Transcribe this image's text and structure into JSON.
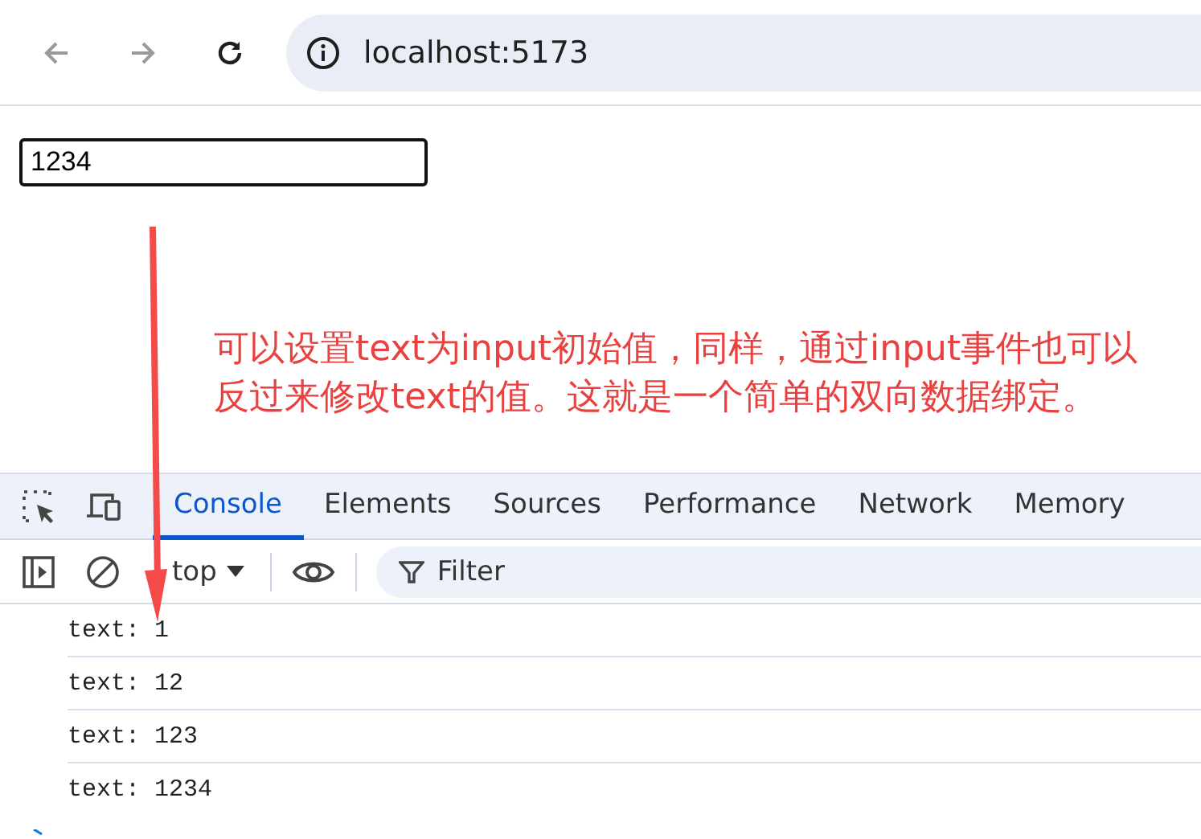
{
  "browser": {
    "nav_buttons": [
      {
        "kind": "back",
        "disabled": true
      },
      {
        "kind": "forward",
        "disabled": true
      },
      {
        "kind": "reload",
        "disabled": false
      }
    ],
    "url": "localhost:5173"
  },
  "page": {
    "input": {
      "value": "1234"
    }
  },
  "annotation": {
    "text": "可以设置text为input初始值，同样，通过input事件也可以反过来修改text的值。这就是一个简单的双向数据绑定。"
  },
  "devtools": {
    "tabs": [
      {
        "label": "Console",
        "selected": true
      },
      {
        "label": "Elements",
        "selected": false
      },
      {
        "label": "Sources",
        "selected": false
      },
      {
        "label": "Performance",
        "selected": false
      },
      {
        "label": "Network",
        "selected": false
      },
      {
        "label": "Memory",
        "selected": false
      }
    ],
    "context": "top",
    "filter": {
      "placeholder": "Filter"
    },
    "logs": [
      "text: 1",
      "text: 12",
      "text: 123",
      "text: 1234"
    ]
  }
}
